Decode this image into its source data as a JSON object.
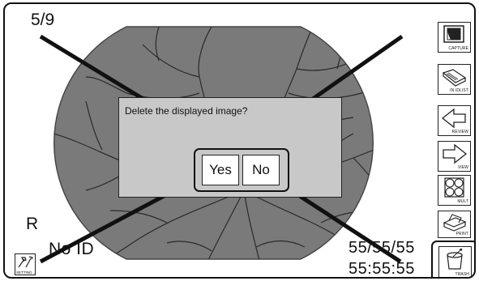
{
  "status": {
    "image_counter": "5/9",
    "eye": "R",
    "patient_id": "No ID",
    "date": "55/55/55",
    "time": "55:55:55"
  },
  "dialog": {
    "message": "Delete the displayed image?",
    "yes_label": "Yes",
    "no_label": "No"
  },
  "sidebar": {
    "capture": "CAPTURE",
    "idlist": "IN IDLIST",
    "review": "REVIEW",
    "view": "VIEW",
    "mult": "MULT",
    "print": "PRINT",
    "trash": "TRASH"
  },
  "settings_label": "SETTING",
  "colors": {
    "fundus": "#7a7a7a",
    "vessel": "#2a2a2a",
    "dialog_bg": "#c8c8c8"
  }
}
